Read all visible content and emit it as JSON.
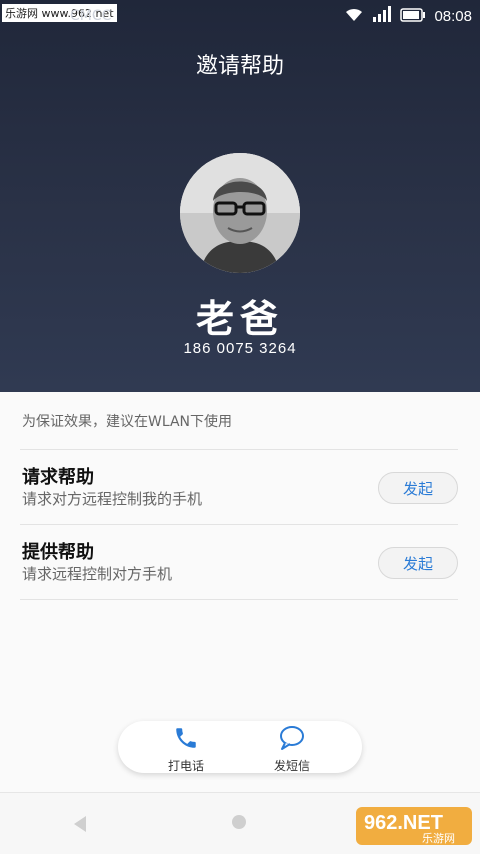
{
  "statusbar": {
    "watermark": "乐游网 www.962.net",
    "carrier": "CMCC",
    "time": "08:08"
  },
  "header": {
    "title": "邀请帮助",
    "contact_name": "老爸",
    "phone_number": "186 0075 3264"
  },
  "panel": {
    "tip": "为保证效果，建议在WLAN下使用",
    "options": [
      {
        "title": "请求帮助",
        "subtitle": "请求对方远程控制我的手机",
        "button": "发起"
      },
      {
        "title": "提供帮助",
        "subtitle": "请求远程控制对方手机",
        "button": "发起"
      }
    ]
  },
  "actions": {
    "call_label": "打电话",
    "sms_label": "发短信"
  },
  "watermark_logo": {
    "text": "962.NET",
    "subtext": "乐游网"
  },
  "colors": {
    "accent": "#2a7bd6",
    "header_bg": "#262e42"
  }
}
